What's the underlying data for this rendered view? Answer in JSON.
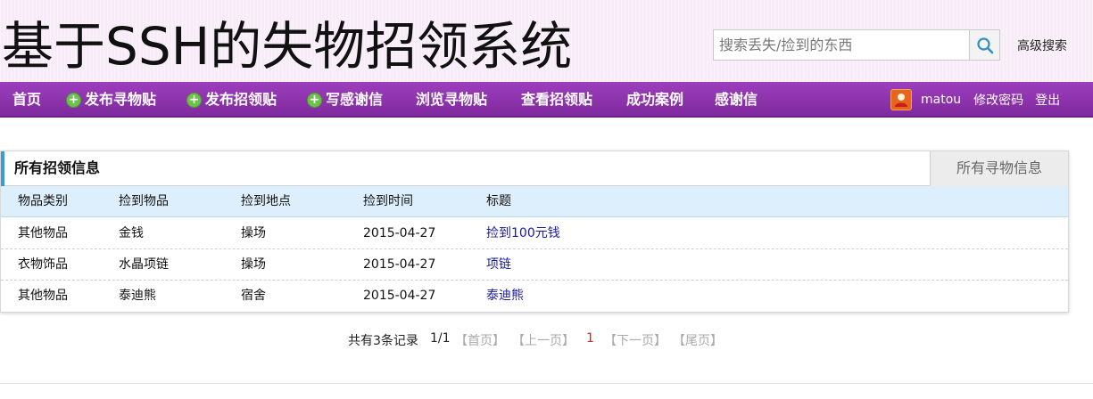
{
  "header": {
    "site_title": "基于SSH的失物招领系统",
    "search_placeholder": "搜索丢失/捡到的东西",
    "search_icon": "search-icon",
    "advanced_search": "高级搜索"
  },
  "nav": {
    "items": [
      {
        "label": "首页",
        "plus": false
      },
      {
        "label": "发布寻物贴",
        "plus": true
      },
      {
        "label": "发布招领贴",
        "plus": true
      },
      {
        "label": "写感谢信",
        "plus": true
      },
      {
        "label": "浏览寻物贴",
        "plus": false
      },
      {
        "label": "查看招领贴",
        "plus": false
      },
      {
        "label": "成功案例",
        "plus": false
      },
      {
        "label": "感谢信",
        "plus": false
      }
    ],
    "username": "matou",
    "change_password": "修改密码",
    "logout": "登出"
  },
  "panel": {
    "title": "所有招领信息",
    "tab": "所有寻物信息",
    "columns": [
      "物品类别",
      "捡到物品",
      "捡到地点",
      "捡到时间",
      "标题"
    ],
    "rows": [
      [
        "其他物品",
        "金钱",
        "操场",
        "2015-04-27",
        "捡到100元钱"
      ],
      [
        "衣物饰品",
        "水晶项链",
        "操场",
        "2015-04-27",
        "项链"
      ],
      [
        "其他物品",
        "泰迪熊",
        "宿舍",
        "2015-04-27",
        "泰迪熊"
      ]
    ]
  },
  "pagination": {
    "total": "共有3条记录",
    "page_of": "1/1",
    "first": "【首页】",
    "prev": "【上一页】",
    "current": "1",
    "next": "【下一页】",
    "last": "【尾页】"
  },
  "colors": {
    "nav_bg": "#8b34ab",
    "header_bg": "#f9ecf9",
    "table_head_bg": "#ddeefc",
    "link": "#1a1aa0",
    "accent": "#3a9ad9"
  }
}
